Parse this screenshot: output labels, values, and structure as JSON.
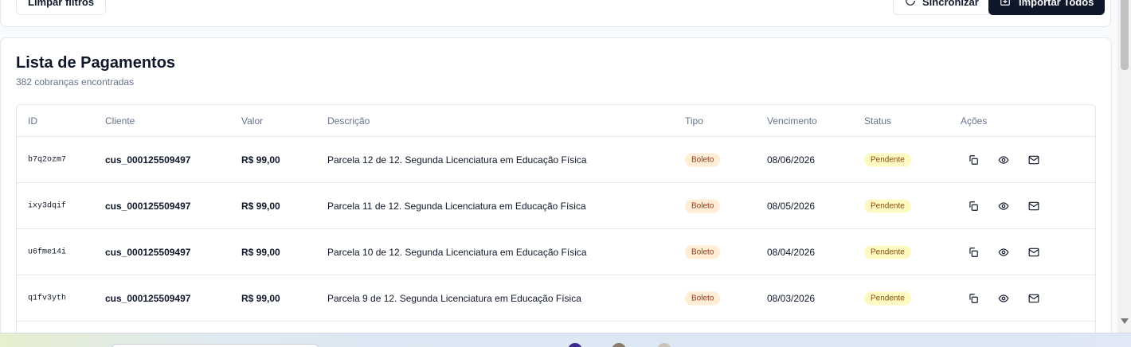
{
  "top_bar": {
    "clear_filters": "Limpar filtros",
    "sync": "Sincronizar",
    "import_all": "Importar Todos"
  },
  "card": {
    "title": "Lista de Pagamentos",
    "subtitle": "382 cobranças encontradas"
  },
  "table": {
    "headers": {
      "id": "ID",
      "cliente": "Cliente",
      "valor": "Valor",
      "descricao": "Descrição",
      "tipo": "Tipo",
      "vencimento": "Vencimento",
      "status": "Status",
      "acoes": "Ações"
    },
    "rows": [
      {
        "id": "b7q2ozm7",
        "cliente": "cus_000125509497",
        "valor": "R$ 99,00",
        "descricao": "Parcela 12 de 12. Segunda Licenciatura em Educação Física",
        "tipo": "Boleto",
        "vencimento": "08/06/2026",
        "status": "Pendente"
      },
      {
        "id": "ixy3dqif",
        "cliente": "cus_000125509497",
        "valor": "R$ 99,00",
        "descricao": "Parcela 11 de 12. Segunda Licenciatura em Educação Física",
        "tipo": "Boleto",
        "vencimento": "08/05/2026",
        "status": "Pendente"
      },
      {
        "id": "u6fme14i",
        "cliente": "cus_000125509497",
        "valor": "R$ 99,00",
        "descricao": "Parcela 10 de 12. Segunda Licenciatura em Educação Física",
        "tipo": "Boleto",
        "vencimento": "08/04/2026",
        "status": "Pendente"
      },
      {
        "id": "q1fv3yth",
        "cliente": "cus_000125509497",
        "valor": "R$ 99,00",
        "descricao": "Parcela 9 de 12. Segunda Licenciatura em Educação Física",
        "tipo": "Boleto",
        "vencimento": "08/03/2026",
        "status": "Pendente"
      }
    ]
  },
  "icons": {
    "copy": "copy-icon",
    "view": "eye-icon",
    "email": "mail-icon",
    "sync": "refresh-icon",
    "import": "download-icon"
  },
  "colors": {
    "primary_dark": "#0f172a",
    "badge_tipo_bg": "#ffedd5",
    "badge_tipo_text": "#9a3412",
    "badge_status_bg": "#fef9c3",
    "badge_status_text": "#854d0e"
  }
}
